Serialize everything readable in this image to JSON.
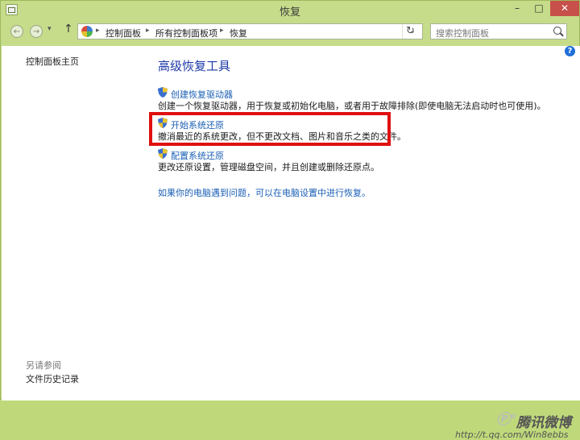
{
  "window": {
    "title": "恢复"
  },
  "titlebar_buttons": {
    "minimize": "–",
    "maximize": "□",
    "close": "✕"
  },
  "addressbar": {
    "crumbs": [
      "控制面板",
      "所有控制面板项",
      "恢复"
    ],
    "separator": "▸",
    "dropdown": "⌄",
    "refresh": "↻"
  },
  "search": {
    "placeholder": "搜索控制面板"
  },
  "help": "?",
  "sidebar": {
    "home": "控制面板主页",
    "see_also": "另请参阅",
    "links": [
      "文件历史记录"
    ]
  },
  "main": {
    "title": "高级恢复工具",
    "tasks": [
      {
        "link": "创建恢复驱动器",
        "desc": "创建一个恢复驱动器，用于恢复或初始化电脑，或者用于故障排除(即使电脑无法启动时也可使用)。"
      },
      {
        "link": "开始系统还原",
        "desc": "撤消最近的系统更改，但不更改文档、图片和音乐之类的文件。"
      },
      {
        "link": "配置系统还原",
        "desc": "更改还原设置，管理磁盘空间，并且创建或删除还原点。"
      }
    ],
    "bottom_link": "如果你的电脑遇到问题，可以在电脑设置中进行恢复。"
  },
  "watermark": {
    "logo": "Ⓟ°",
    "brand": "腾讯微博",
    "url": "http://t.qq.com/Win8ebbs"
  },
  "colors": {
    "titlebar": "#c6dc8a",
    "link": "#1a5fb4",
    "heading": "#1e3aa8",
    "highlight_box": "#e01010"
  }
}
